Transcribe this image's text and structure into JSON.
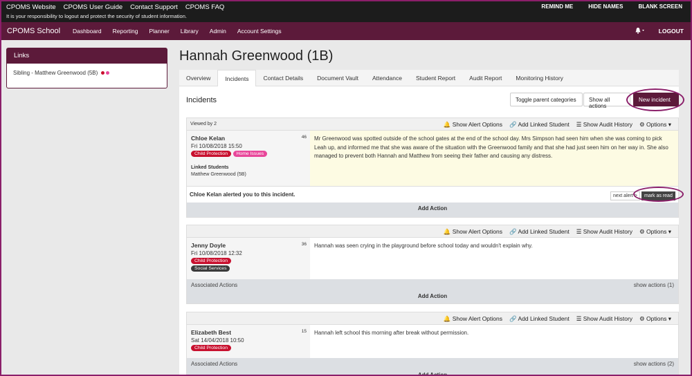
{
  "topbar": {
    "links": [
      "CPOMS Website",
      "CPOMS User Guide",
      "Contact Support",
      "CPOMS FAQ"
    ],
    "note": "It is your responsibility to logout and protect the security of student information.",
    "right": [
      "REMIND ME",
      "HIDE NAMES",
      "BLANK SCREEN"
    ]
  },
  "nav": {
    "brand": "CPOMS School",
    "items": [
      "Dashboard",
      "Reporting",
      "Planner",
      "Library",
      "Admin",
      "Account Settings"
    ],
    "logout": "LOGOUT"
  },
  "links_panel": {
    "title": "Links",
    "sibling_prefix": "Sibling - ",
    "sibling_name": "Matthew Greenwood",
    "sibling_form": "(5B)"
  },
  "student": {
    "name": "Hannah Greenwood (1B)"
  },
  "tabs": [
    "Overview",
    "Incidents",
    "Contact Details",
    "Document Vault",
    "Attendance",
    "Student Report",
    "Audit Report",
    "Monitoring History"
  ],
  "incidents": {
    "title": "Incidents",
    "toggle_label": "Toggle parent categories",
    "show_all_label": "Show all actions",
    "new_label": "New incident"
  },
  "card_actions": [
    "Show Alert Options",
    "Add Linked Student",
    "Show Audit History",
    "Options"
  ],
  "cards": [
    {
      "viewed": "Viewed by 2",
      "name": "Chloe Kelan",
      "date": "Fri 10/08/2018 15:50",
      "count": "46",
      "tags": [
        "Child Protection",
        "Home Issues"
      ],
      "description": "Mr Greenwood was spotted outside of the school gates at the end of the school day. Mrs Simpson had seen him when she was coming to pick Leah up, and informed me that she was aware of the situation with the Greenwood family and that she had just seen him on her way in. She also managed to prevent both Hannah and Matthew from seeing their father and causing any distress.",
      "linked_label": "Linked Students",
      "linked_name": "Matthew Greenwood",
      "linked_form": "(5B)",
      "alert": "Chloe Kelan alerted you to this incident.",
      "next_alert": "next alert",
      "mark_read": "mark as read",
      "add_action": "Add Action"
    },
    {
      "name": "Jenny Doyle",
      "date": "Fri 10/08/2018 12:32",
      "count": "36",
      "tags": [
        "Child Protection",
        "Social Services"
      ],
      "description": "Hannah was seen crying in the playground before school today and wouldn't explain why.",
      "assoc_label": "Associated Actions",
      "show_actions": "show actions (1)",
      "add_action": "Add Action"
    },
    {
      "name": "Elizabeth Best",
      "date": "Sat 14/04/2018 10:50",
      "count": "15",
      "tags": [
        "Child Protection"
      ],
      "description": "Hannah left school this morning after break without permission.",
      "assoc_label": "Associated Actions",
      "show_actions": "show actions (2)",
      "add_action": "Add Action"
    }
  ],
  "colors": {
    "brand": "#5c1a3a",
    "child_protection": "#c8102e",
    "home_issues": "#e8479a",
    "social_services": "#3a3a3a",
    "highlight": "#fdfbe3"
  }
}
